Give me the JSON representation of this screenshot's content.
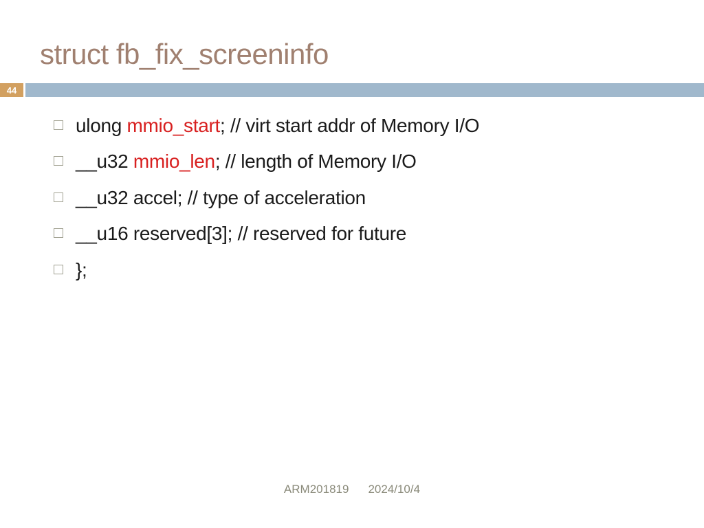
{
  "title": "struct fb_fix_screeninfo",
  "page_number": "44",
  "items": [
    {
      "pre": "ulong ",
      "hl": "mmio_start",
      "post": "; // virt start addr of Memory I/O"
    },
    {
      "pre": "__u32 ",
      "hl": "mmio_len",
      "post": "; // length of Memory I/O"
    },
    {
      "pre": "__u32 accel; // type of acceleration",
      "hl": "",
      "post": ""
    },
    {
      "pre": "__u16 reserved[3]; // reserved for future",
      "hl": "",
      "post": ""
    },
    {
      "pre": "};",
      "hl": "",
      "post": ""
    }
  ],
  "footer": {
    "left": "ARM201819",
    "right": "2024/10/4"
  }
}
